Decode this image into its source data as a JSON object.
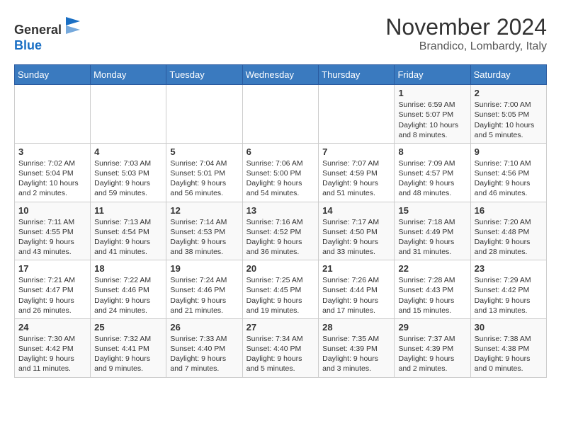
{
  "header": {
    "logo_line1": "General",
    "logo_line2": "Blue",
    "month_title": "November 2024",
    "location": "Brandico, Lombardy, Italy"
  },
  "weekdays": [
    "Sunday",
    "Monday",
    "Tuesday",
    "Wednesday",
    "Thursday",
    "Friday",
    "Saturday"
  ],
  "weeks": [
    [
      {
        "day": "",
        "info": ""
      },
      {
        "day": "",
        "info": ""
      },
      {
        "day": "",
        "info": ""
      },
      {
        "day": "",
        "info": ""
      },
      {
        "day": "",
        "info": ""
      },
      {
        "day": "1",
        "info": "Sunrise: 6:59 AM\nSunset: 5:07 PM\nDaylight: 10 hours and 8 minutes."
      },
      {
        "day": "2",
        "info": "Sunrise: 7:00 AM\nSunset: 5:05 PM\nDaylight: 10 hours and 5 minutes."
      }
    ],
    [
      {
        "day": "3",
        "info": "Sunrise: 7:02 AM\nSunset: 5:04 PM\nDaylight: 10 hours and 2 minutes."
      },
      {
        "day": "4",
        "info": "Sunrise: 7:03 AM\nSunset: 5:03 PM\nDaylight: 9 hours and 59 minutes."
      },
      {
        "day": "5",
        "info": "Sunrise: 7:04 AM\nSunset: 5:01 PM\nDaylight: 9 hours and 56 minutes."
      },
      {
        "day": "6",
        "info": "Sunrise: 7:06 AM\nSunset: 5:00 PM\nDaylight: 9 hours and 54 minutes."
      },
      {
        "day": "7",
        "info": "Sunrise: 7:07 AM\nSunset: 4:59 PM\nDaylight: 9 hours and 51 minutes."
      },
      {
        "day": "8",
        "info": "Sunrise: 7:09 AM\nSunset: 4:57 PM\nDaylight: 9 hours and 48 minutes."
      },
      {
        "day": "9",
        "info": "Sunrise: 7:10 AM\nSunset: 4:56 PM\nDaylight: 9 hours and 46 minutes."
      }
    ],
    [
      {
        "day": "10",
        "info": "Sunrise: 7:11 AM\nSunset: 4:55 PM\nDaylight: 9 hours and 43 minutes."
      },
      {
        "day": "11",
        "info": "Sunrise: 7:13 AM\nSunset: 4:54 PM\nDaylight: 9 hours and 41 minutes."
      },
      {
        "day": "12",
        "info": "Sunrise: 7:14 AM\nSunset: 4:53 PM\nDaylight: 9 hours and 38 minutes."
      },
      {
        "day": "13",
        "info": "Sunrise: 7:16 AM\nSunset: 4:52 PM\nDaylight: 9 hours and 36 minutes."
      },
      {
        "day": "14",
        "info": "Sunrise: 7:17 AM\nSunset: 4:50 PM\nDaylight: 9 hours and 33 minutes."
      },
      {
        "day": "15",
        "info": "Sunrise: 7:18 AM\nSunset: 4:49 PM\nDaylight: 9 hours and 31 minutes."
      },
      {
        "day": "16",
        "info": "Sunrise: 7:20 AM\nSunset: 4:48 PM\nDaylight: 9 hours and 28 minutes."
      }
    ],
    [
      {
        "day": "17",
        "info": "Sunrise: 7:21 AM\nSunset: 4:47 PM\nDaylight: 9 hours and 26 minutes."
      },
      {
        "day": "18",
        "info": "Sunrise: 7:22 AM\nSunset: 4:46 PM\nDaylight: 9 hours and 24 minutes."
      },
      {
        "day": "19",
        "info": "Sunrise: 7:24 AM\nSunset: 4:46 PM\nDaylight: 9 hours and 21 minutes."
      },
      {
        "day": "20",
        "info": "Sunrise: 7:25 AM\nSunset: 4:45 PM\nDaylight: 9 hours and 19 minutes."
      },
      {
        "day": "21",
        "info": "Sunrise: 7:26 AM\nSunset: 4:44 PM\nDaylight: 9 hours and 17 minutes."
      },
      {
        "day": "22",
        "info": "Sunrise: 7:28 AM\nSunset: 4:43 PM\nDaylight: 9 hours and 15 minutes."
      },
      {
        "day": "23",
        "info": "Sunrise: 7:29 AM\nSunset: 4:42 PM\nDaylight: 9 hours and 13 minutes."
      }
    ],
    [
      {
        "day": "24",
        "info": "Sunrise: 7:30 AM\nSunset: 4:42 PM\nDaylight: 9 hours and 11 minutes."
      },
      {
        "day": "25",
        "info": "Sunrise: 7:32 AM\nSunset: 4:41 PM\nDaylight: 9 hours and 9 minutes."
      },
      {
        "day": "26",
        "info": "Sunrise: 7:33 AM\nSunset: 4:40 PM\nDaylight: 9 hours and 7 minutes."
      },
      {
        "day": "27",
        "info": "Sunrise: 7:34 AM\nSunset: 4:40 PM\nDaylight: 9 hours and 5 minutes."
      },
      {
        "day": "28",
        "info": "Sunrise: 7:35 AM\nSunset: 4:39 PM\nDaylight: 9 hours and 3 minutes."
      },
      {
        "day": "29",
        "info": "Sunrise: 7:37 AM\nSunset: 4:39 PM\nDaylight: 9 hours and 2 minutes."
      },
      {
        "day": "30",
        "info": "Sunrise: 7:38 AM\nSunset: 4:38 PM\nDaylight: 9 hours and 0 minutes."
      }
    ]
  ]
}
